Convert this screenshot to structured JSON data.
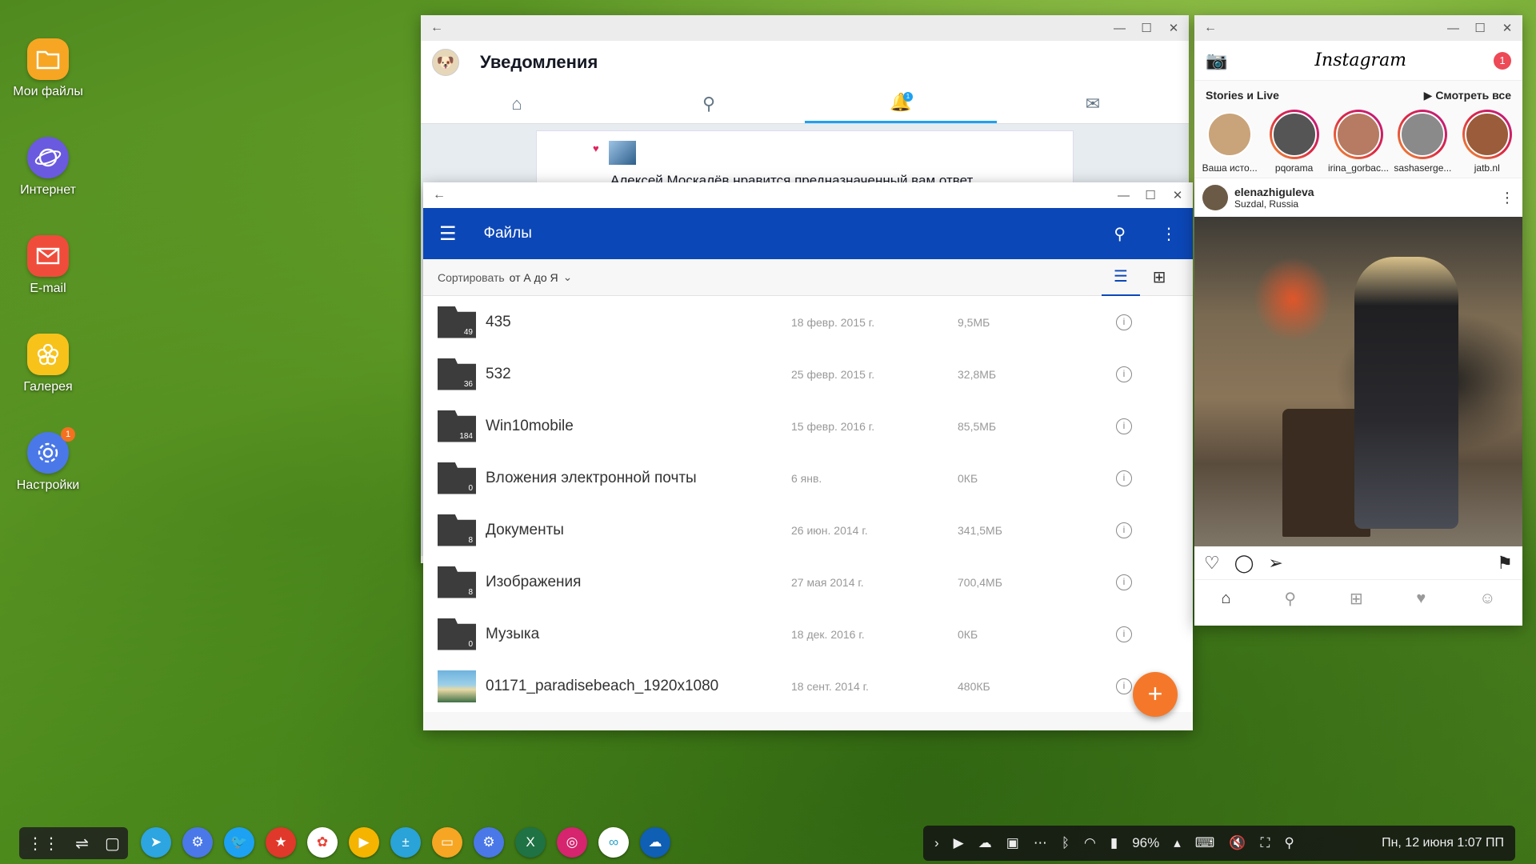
{
  "desktop": {
    "icons": [
      {
        "label": "Мои файлы",
        "icon": "folder-icon",
        "color": "#f6a623"
      },
      {
        "label": "Интернет",
        "icon": "planet-icon",
        "color": "#6a5ae0"
      },
      {
        "label": "E-mail",
        "icon": "envelope-icon",
        "color": "#f04c3b"
      },
      {
        "label": "Галерея",
        "icon": "flower-icon",
        "color": "#f7c21a"
      },
      {
        "label": "Настройки",
        "icon": "gear-icon",
        "color": "#4a78e8",
        "badge": "1"
      }
    ]
  },
  "twitter": {
    "title": "Уведомления",
    "notification_badge": "1",
    "notification_text": "Алексей Москалёв нравится предназначенный вам ответ",
    "accent": "#1da1f2"
  },
  "files": {
    "title": "Файлы",
    "sort_label": "Сортировать",
    "sort_value": "от А до Я",
    "accent": "#0c47b7",
    "rows": [
      {
        "name": "435",
        "count": "49",
        "date": "18 февр. 2015 г.",
        "size": "9,5МБ",
        "type": "folder"
      },
      {
        "name": "532",
        "count": "36",
        "date": "25 февр. 2015 г.",
        "size": "32,8МБ",
        "type": "folder"
      },
      {
        "name": "Win10mobile",
        "count": "184",
        "date": "15 февр. 2016 г.",
        "size": "85,5МБ",
        "type": "folder"
      },
      {
        "name": "Вложения электронной почты",
        "count": "0",
        "date": "6 янв.",
        "size": "0КБ",
        "type": "folder"
      },
      {
        "name": "Документы",
        "count": "8",
        "date": "26 июн. 2014 г.",
        "size": "341,5МБ",
        "type": "folder"
      },
      {
        "name": "Изображения",
        "count": "8",
        "date": "27 мая 2014 г.",
        "size": "700,4МБ",
        "type": "folder"
      },
      {
        "name": "Музыка",
        "count": "0",
        "date": "18 дек. 2016 г.",
        "size": "0КБ",
        "type": "folder"
      },
      {
        "name": "01171_paradisebeach_1920x1080",
        "count": "",
        "date": "18 сент. 2014 г.",
        "size": "480КБ",
        "type": "image"
      }
    ]
  },
  "instagram": {
    "logo": "Instagram",
    "notif_count": "1",
    "stories_label": "Stories и Live",
    "watch_all": "▶ Смотреть все",
    "stories": [
      "Ваша исто...",
      "pqorama",
      "irina_gorbac...",
      "sashaserge...",
      "jatb.nl"
    ],
    "post_user": "elenazhiguleva",
    "post_location": "Suzdal, Russia"
  },
  "taskbar": {
    "battery": "96%",
    "clock": "Пн, 12 июня  1:07 ПП"
  }
}
